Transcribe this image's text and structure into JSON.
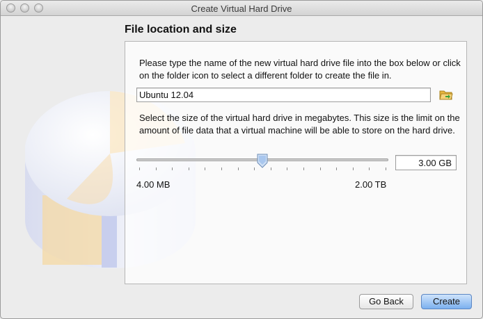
{
  "window": {
    "title": "Create Virtual Hard Drive"
  },
  "page": {
    "heading": "File location and size",
    "location_description": "Please type the name of the new virtual hard drive file into the box below or click on the folder icon to select a different folder to create the file in.",
    "file_name": "Ubuntu 12.04",
    "size_description": "Select the size of the virtual hard drive in megabytes. This size is the limit on the amount of file data that a virtual machine will be able to store on the hard drive.",
    "size_value": "3.00 GB",
    "slider": {
      "min_label": "4.00 MB",
      "max_label": "2.00 TB",
      "position_fraction": 0.5
    }
  },
  "buttons": {
    "back": "Go Back",
    "create": "Create"
  },
  "icons": {
    "folder": "folder-open-icon",
    "disk_graphic": "hard-drive-pie-graphic"
  },
  "colors": {
    "accent": "#7bb0ef",
    "folder": "#f0c24a",
    "folder_arrow": "#3aa03a"
  }
}
